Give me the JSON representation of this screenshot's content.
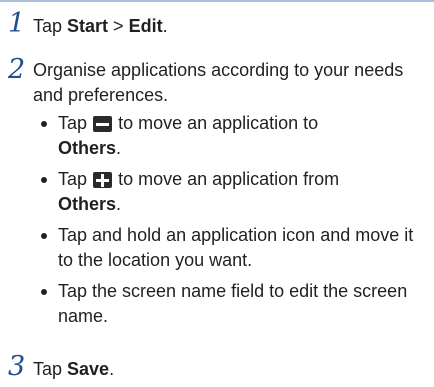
{
  "steps": [
    {
      "number": "1",
      "parts": [
        "Tap ",
        "Start",
        " > ",
        "Edit",
        "."
      ]
    },
    {
      "number": "2",
      "text": "Organise applications according to your needs and preferences.",
      "bullets": [
        {
          "before_icon": "Tap",
          "icon": "minus-icon",
          "after_icon": "to move an application to",
          "bold": "Others",
          "end": "."
        },
        {
          "before_icon": "Tap",
          "icon": "plus-icon",
          "after_icon": "to move an application from",
          "bold": "Others",
          "end": "."
        },
        {
          "text": "Tap and hold an application icon and move it to the location you want."
        },
        {
          "text": "Tap the screen name field to edit the screen name."
        }
      ]
    },
    {
      "number": "3",
      "parts": [
        "Tap ",
        "Save",
        "."
      ]
    }
  ],
  "colors": {
    "step_number": "#1f4e8c",
    "text": "#231f20",
    "top_rule": "#a8c0dc",
    "icon_bg": "#2b2b2b"
  }
}
